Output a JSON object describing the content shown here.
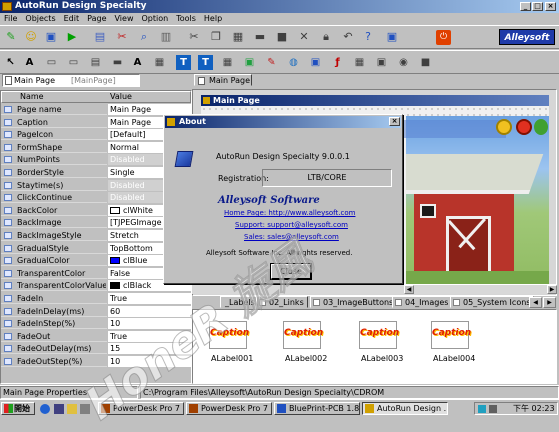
{
  "window": {
    "title": "AutoRun Design Specialty"
  },
  "menu": [
    "File",
    "Objects",
    "Edit",
    "Page",
    "View",
    "Option",
    "Tools",
    "Help"
  ],
  "brand": "Alleysoft",
  "toolbar1": [
    "new-icon",
    "open-icon",
    "save-icon",
    "run-icon",
    "page-icon",
    "image-icon",
    "cut-icon",
    "copy-icon",
    "paste-icon",
    "align-icon",
    "delete-icon",
    "undo-icon",
    "help-icon",
    "exit-icon"
  ],
  "page_selector": {
    "value": "Main Page",
    "placeholder": "[MainPage]"
  },
  "props": {
    "headers": {
      "name": "Name",
      "value": "Value"
    },
    "rows": [
      {
        "name": "Page name",
        "value": "Main Page",
        "dis": false
      },
      {
        "name": "Caption",
        "value": "Main Page",
        "dis": false
      },
      {
        "name": "PageIcon",
        "value": "[Default]",
        "dis": false
      },
      {
        "name": "FormShape",
        "value": "Normal",
        "dis": false
      },
      {
        "name": "NumPoints",
        "value": "Disabled",
        "dis": true
      },
      {
        "name": "BorderStyle",
        "value": "Single",
        "dis": false
      },
      {
        "name": "Staytime(s)",
        "value": "Disabled",
        "dis": true
      },
      {
        "name": "ClickContinue",
        "value": "Disabled",
        "dis": true
      },
      {
        "name": "BackColor",
        "value": "clWhite",
        "dis": false,
        "swatch": "#ffffff"
      },
      {
        "name": "BackImage",
        "value": "[TJPEGImage",
        "dis": false
      },
      {
        "name": "BackImageStyle",
        "value": "Stretch",
        "dis": false
      },
      {
        "name": "GradualStyle",
        "value": "TopBottom",
        "dis": false
      },
      {
        "name": "GradualColor",
        "value": "clBlue",
        "dis": false,
        "swatch": "#0000ff"
      },
      {
        "name": "TransparentColor",
        "value": "False",
        "dis": false
      },
      {
        "name": "TransparentColorValue",
        "value": "clBlack",
        "dis": false,
        "swatch": "#000000"
      },
      {
        "name": "FadeIn",
        "value": "True",
        "dis": false
      },
      {
        "name": "FadeInDelay(ms)",
        "value": "60",
        "dis": false
      },
      {
        "name": "FadeInStep(%)",
        "value": "10",
        "dis": false
      },
      {
        "name": "FadeOut",
        "value": "True",
        "dis": false
      },
      {
        "name": "FadeOutDelay(ms)",
        "value": "15",
        "dis": false
      },
      {
        "name": "FadeOutStep(%)",
        "value": "10",
        "dis": false
      }
    ]
  },
  "tabs": {
    "main": "Main Page"
  },
  "canvas": {
    "title": "Main Page"
  },
  "lib_tabs": [
    "_Labels",
    "02_Links",
    "03_ImageButtons",
    "04_Images",
    "05_System Icons"
  ],
  "lib_items": [
    {
      "caption": "Caption",
      "label": "ALabel001"
    },
    {
      "caption": "Caption",
      "label": "ALabel002"
    },
    {
      "caption": "Caption",
      "label": "ALabel003"
    },
    {
      "caption": "Caption",
      "label": "ALabel004"
    }
  ],
  "about": {
    "title": "About",
    "version": "AutoRun Design Specialty 9.0.0.1",
    "reg_label": "Registration:",
    "reg_value": "LTB/CORE",
    "company": "Alleysoft Software",
    "home": "Home Page: http://www.alleysoft.com",
    "support": "Support: support@alleysoft.com",
    "sales": "Sales: sales@alleysoft.com",
    "rights": "Alleysoft Software Inc. All rights reserved.",
    "close": "Close"
  },
  "status": {
    "left": "Main Page Properties",
    "path": "C:\\Program Files\\Alleysoft\\AutoRun Design Specialty\\CDROM"
  },
  "taskbar": {
    "start": "開始",
    "items": [
      "PowerDesk Pro 7 ...",
      "PowerDesk Pro 7 ...",
      "BluePrint-PCB 1.8",
      "AutoRun Design ..."
    ],
    "clock": "下午 02:23"
  },
  "watermark": "HoneR 旋風"
}
